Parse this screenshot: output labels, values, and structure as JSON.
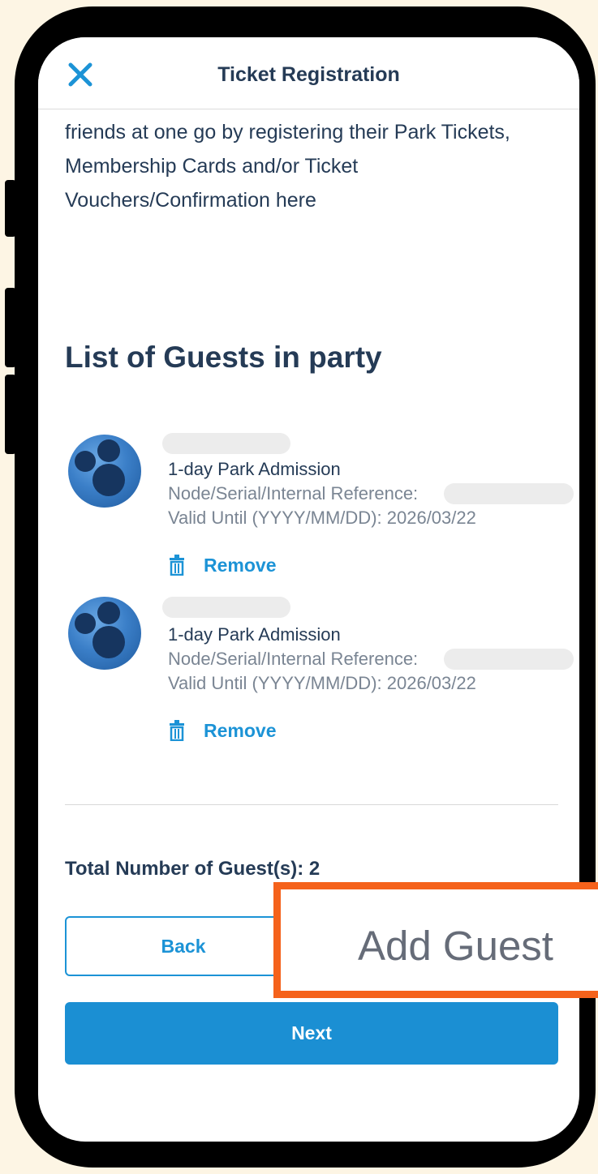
{
  "header": {
    "title": "Ticket Registration"
  },
  "intro": {
    "lines": [
      "friends at one go by registering their Park Tickets,",
      "Membership Cards and/or Ticket",
      "Vouchers/Confirmation here"
    ]
  },
  "section": {
    "title": "List of Guests in party"
  },
  "guests": [
    {
      "ticket": "1-day Park Admission",
      "reference_label": "Node/Serial/Internal Reference:",
      "valid_until": "Valid Until (YYYY/MM/DD): 2026/03/22",
      "remove_label": "Remove"
    },
    {
      "ticket": "1-day Park Admission",
      "reference_label": "Node/Serial/Internal Reference:",
      "valid_until": "Valid Until (YYYY/MM/DD): 2026/03/22",
      "remove_label": "Remove"
    }
  ],
  "total": {
    "label": "Total Number of Guest(s): 2"
  },
  "buttons": {
    "back": "Back",
    "next": "Next"
  },
  "callout": {
    "label": "Add Guest"
  },
  "colors": {
    "accent": "#1c93d6",
    "heading": "#253b56",
    "highlight": "#f5621b"
  }
}
